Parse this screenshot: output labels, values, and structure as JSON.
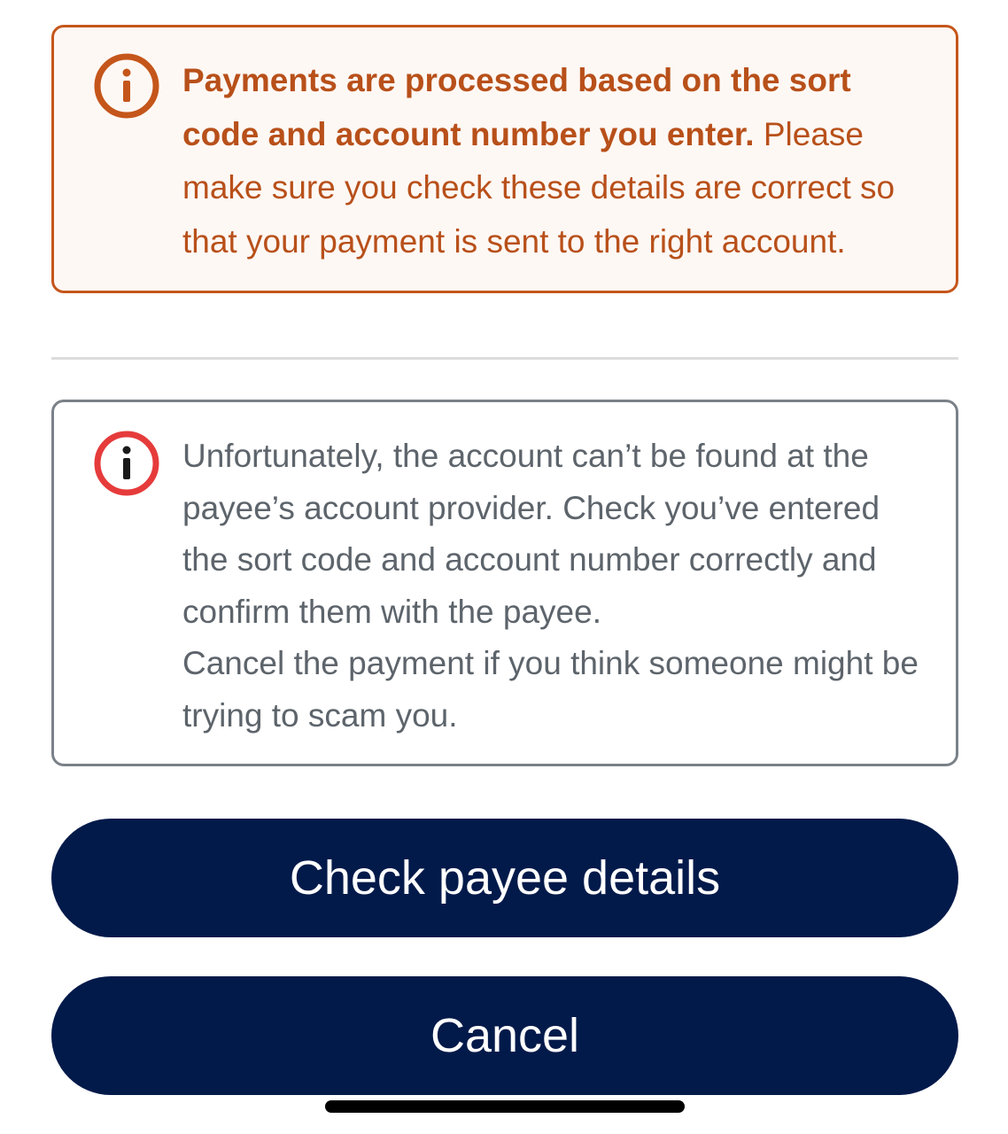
{
  "warning_notice": {
    "bold_text": "Payments are processed based on the sort code and account number you enter.",
    "body_text": " Please make sure you check these details are correct so that your payment is sent to the right account.",
    "icon": "info-circle-icon",
    "color": "#c5561b"
  },
  "error_notice": {
    "paragraph_1": "Unfortunately, the account can’t be found at the payee’s account provider. Check you’ve entered the sort code and account number correctly and confirm them with the payee.",
    "paragraph_2": "Cancel the payment if you think someone might be trying to scam you.",
    "icon": "info-circle-icon",
    "color": "#e63b3b"
  },
  "actions": {
    "check_label": "Check payee details",
    "cancel_label": "Cancel",
    "button_color": "#021a4a"
  }
}
